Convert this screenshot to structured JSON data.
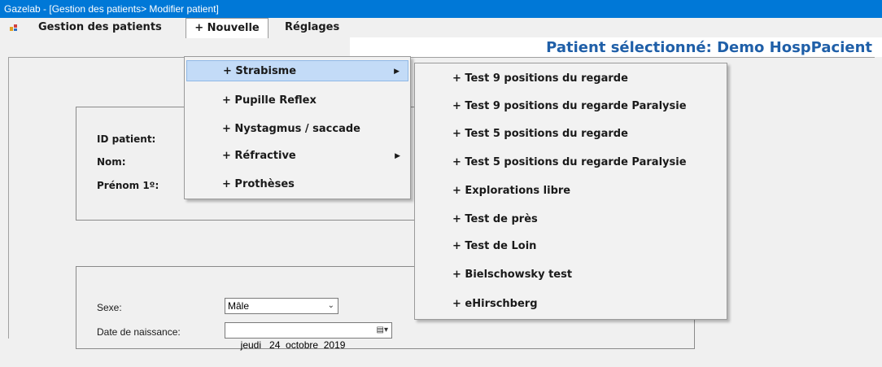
{
  "window": {
    "title": "Gazelab - [Gestion des patients> Modifier patient]"
  },
  "menubar": {
    "items": [
      {
        "label": "Gestion des patients"
      },
      {
        "label": "+ Nouvelle"
      },
      {
        "label": "Réglages"
      }
    ],
    "patient_selected": "Patient sélectionné: Demo HospPacient"
  },
  "form": {
    "id_label": "ID patient:",
    "nom_label": "Nom:",
    "prenom_label": "Prénom 1º:",
    "sexe_label": "Sexe:",
    "sexe_value": "Mâle",
    "dob_label": "Date de naissance:",
    "dob_value": "jeudi   24  octobre  2019"
  },
  "nouvelle_menu": {
    "items": [
      {
        "label": "+ Strabisme",
        "submenu": true
      },
      {
        "label": "+ Pupille Reflex",
        "submenu": false
      },
      {
        "label": "+ Nystagmus / saccade",
        "submenu": false
      },
      {
        "label": "+ Réfractive",
        "submenu": true
      },
      {
        "label": "+ Prothèses",
        "submenu": false
      }
    ]
  },
  "strabisme_submenu": {
    "items": [
      {
        "label": "+ Test 9 positions du regarde"
      },
      {
        "label": "+ Test 9 positions du regarde Paralysie"
      },
      {
        "label": "+ Test 5 positions du regarde"
      },
      {
        "label": "+ Test 5 positions du regarde Paralysie"
      },
      {
        "label": "+ Explorations libre"
      },
      {
        "label": "+ Test de près"
      },
      {
        "label": "+ Test de Loin"
      },
      {
        "label": "+ Bielschowsky test"
      },
      {
        "label": "+ eHirschberg"
      }
    ]
  },
  "colors": {
    "titlebar": "#0078d7",
    "patient_label": "#1f5fa8",
    "highlight": "#c3dbf7"
  }
}
